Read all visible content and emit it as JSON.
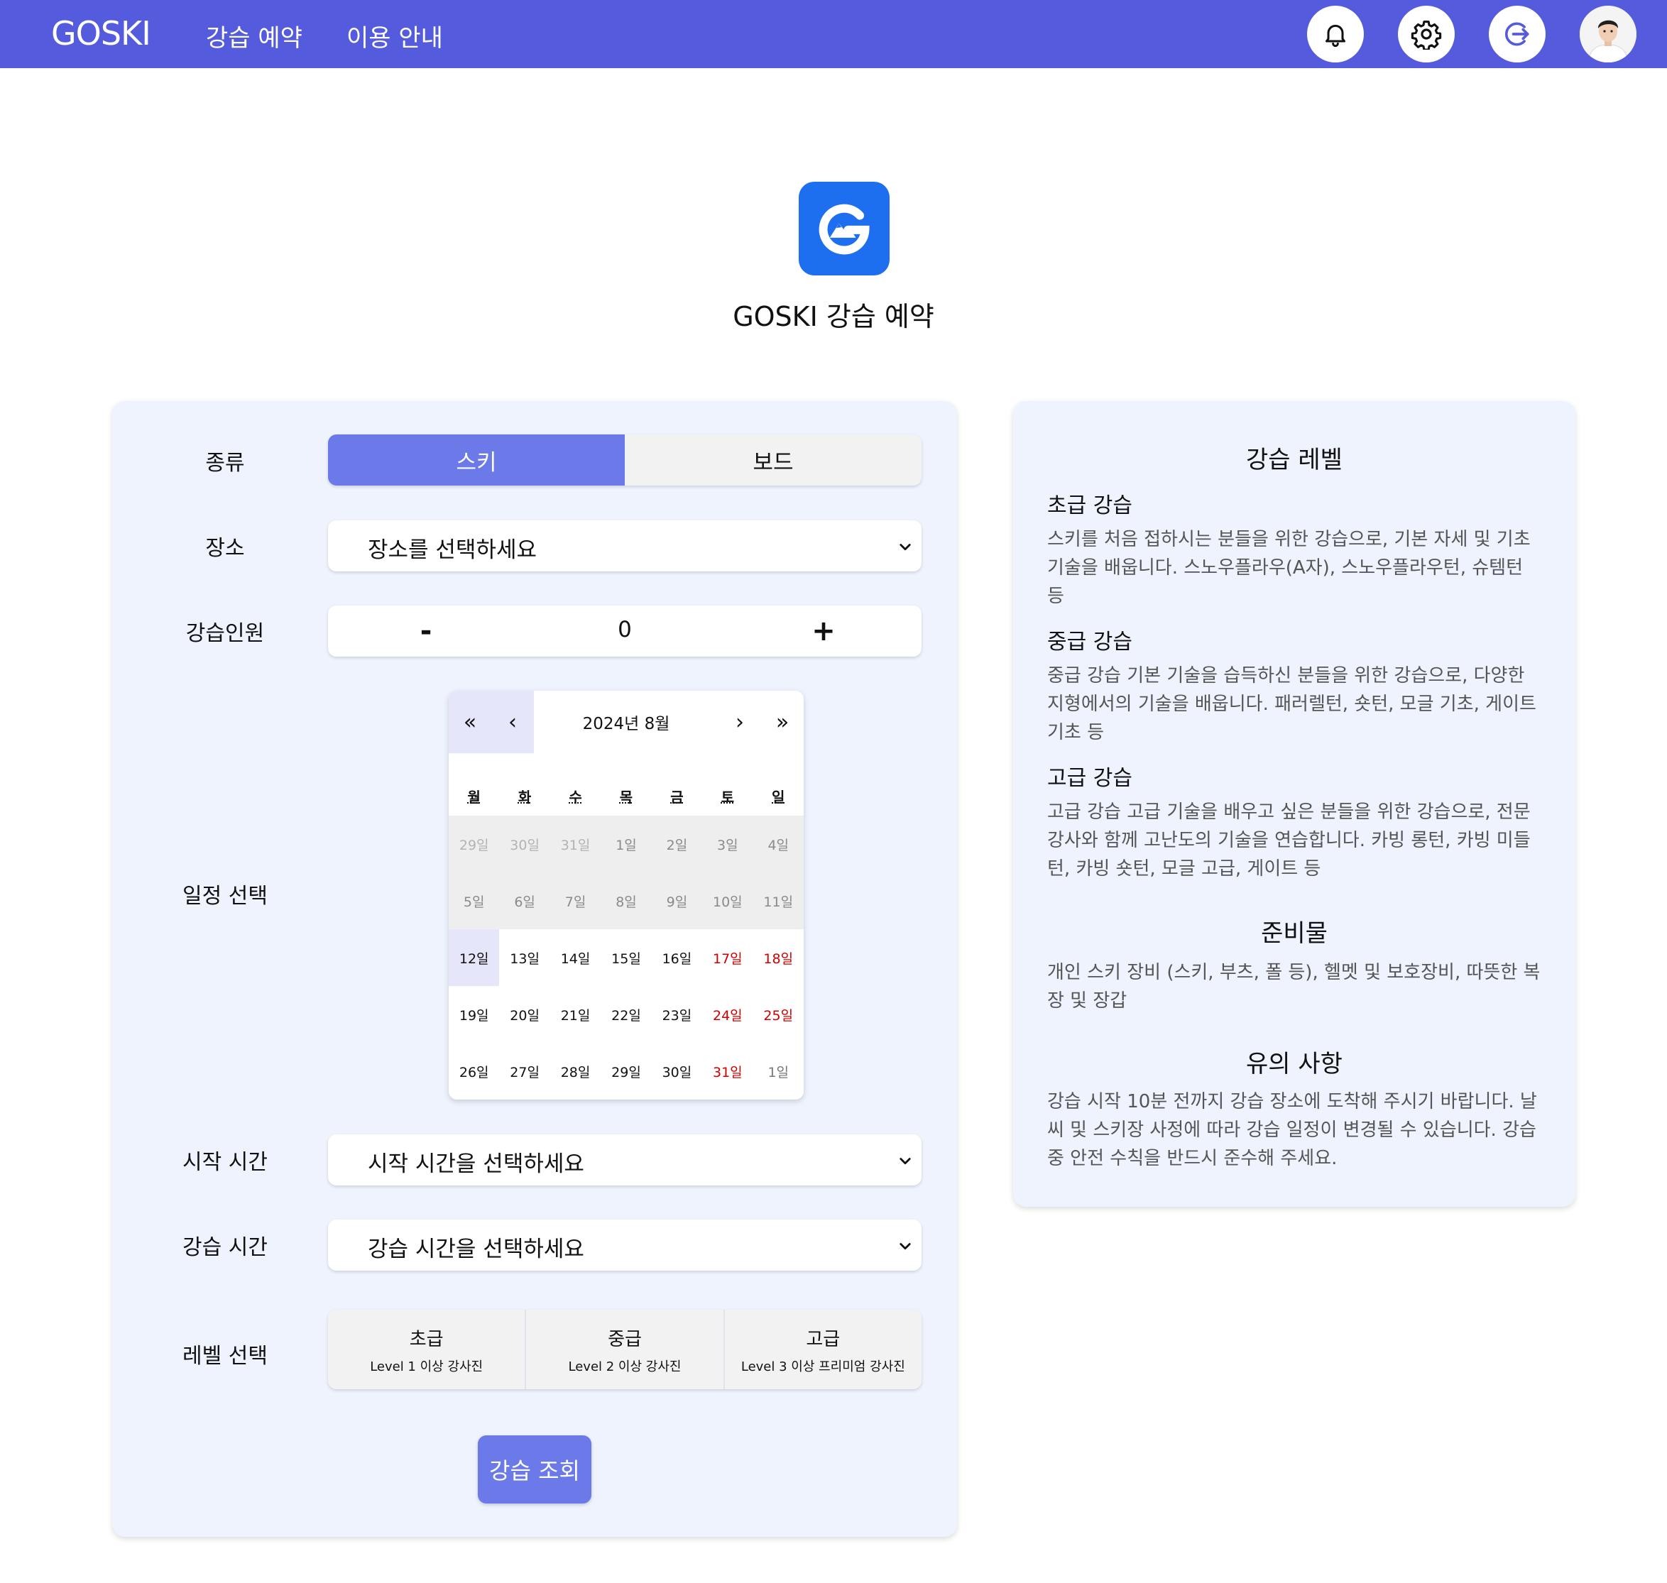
{
  "header": {
    "brand": "GOSKI",
    "nav": [
      "강습 예약",
      "이용 안내"
    ]
  },
  "hero": {
    "title": "GOSKI 강습 예약"
  },
  "form": {
    "type_label": "종류",
    "type_options": [
      "스키",
      "보드"
    ],
    "type_selected": "스키",
    "location_label": "장소",
    "location_placeholder": "장소를 선택하세요",
    "people_label": "강습인원",
    "people_minus": "-",
    "people_value": "0",
    "people_plus": "+",
    "schedule_label": "일정 선택",
    "start_label": "시작 시간",
    "start_placeholder": "시작 시간을 선택하세요",
    "duration_label": "강습 시간",
    "duration_placeholder": "강습 시간을 선택하세요",
    "level_label": "레벨 선택",
    "levels": [
      {
        "name": "초급",
        "desc": "Level 1 이상 강사진"
      },
      {
        "name": "중급",
        "desc": "Level 2 이상 강사진"
      },
      {
        "name": "고급",
        "desc": "Level 3 이상 프리미엄 강사진"
      }
    ],
    "search_button": "강습 조회"
  },
  "calendar": {
    "nav": {
      "prev2": "«",
      "prev": "‹",
      "next": "›",
      "next2": "»"
    },
    "month_label": "2024년 8월",
    "weekdays": [
      "월",
      "화",
      "수",
      "목",
      "금",
      "토",
      "일"
    ],
    "weeks": [
      [
        {
          "d": "29일",
          "s": "other"
        },
        {
          "d": "30일",
          "s": "other"
        },
        {
          "d": "31일",
          "s": "other"
        },
        {
          "d": "1일",
          "s": "past"
        },
        {
          "d": "2일",
          "s": "past"
        },
        {
          "d": "3일",
          "s": "past"
        },
        {
          "d": "4일",
          "s": "past"
        }
      ],
      [
        {
          "d": "5일",
          "s": "past"
        },
        {
          "d": "6일",
          "s": "past"
        },
        {
          "d": "7일",
          "s": "past"
        },
        {
          "d": "8일",
          "s": "past"
        },
        {
          "d": "9일",
          "s": "past"
        },
        {
          "d": "10일",
          "s": "past"
        },
        {
          "d": "11일",
          "s": "past"
        }
      ],
      [
        {
          "d": "12일",
          "s": "today"
        },
        {
          "d": "13일",
          "s": "normal"
        },
        {
          "d": "14일",
          "s": "normal"
        },
        {
          "d": "15일",
          "s": "normal"
        },
        {
          "d": "16일",
          "s": "normal"
        },
        {
          "d": "17일",
          "s": "weekend"
        },
        {
          "d": "18일",
          "s": "weekend"
        }
      ],
      [
        {
          "d": "19일",
          "s": "normal"
        },
        {
          "d": "20일",
          "s": "normal"
        },
        {
          "d": "21일",
          "s": "normal"
        },
        {
          "d": "22일",
          "s": "normal"
        },
        {
          "d": "23일",
          "s": "normal"
        },
        {
          "d": "24일",
          "s": "weekend"
        },
        {
          "d": "25일",
          "s": "weekend"
        }
      ],
      [
        {
          "d": "26일",
          "s": "normal"
        },
        {
          "d": "27일",
          "s": "normal"
        },
        {
          "d": "28일",
          "s": "normal"
        },
        {
          "d": "29일",
          "s": "normal"
        },
        {
          "d": "30일",
          "s": "normal"
        },
        {
          "d": "31일",
          "s": "weekend"
        },
        {
          "d": "1일",
          "s": "next"
        }
      ]
    ]
  },
  "info": {
    "levels_title": "강습 레벨",
    "beginner_title": "초급 강습",
    "beginner_text": "스키를 처음 접하시는 분들을 위한 강습으로, 기본 자세 및 기초 기술을 배웁니다. 스노우플라우(A자), 스노우플라우턴, 슈템턴 등",
    "intermediate_title": "중급 강습",
    "intermediate_text": "중급 강습 기본 기술을 습득하신 분들을 위한 강습으로, 다양한 지형에서의 기술을 배웁니다. 패러렐턴, 숏턴, 모글 기초, 게이트 기초 등",
    "advanced_title": "고급 강습",
    "advanced_text": "고급 강습 고급 기술을 배우고 싶은 분들을 위한 강습으로, 전문 강사와 함께 고난도의 기술을 연습합니다. 카빙 롱턴, 카빙 미들턴, 카빙 숏턴, 모글 고급, 게이트 등",
    "prep_title": "준비물",
    "prep_text": "개인 스키 장비 (스키, 부츠, 폴 등), 헬멧 및 보호장비, 따뜻한 복장 및 장갑",
    "notice_title": "유의 사항",
    "notice_text": "강습 시작 10분 전까지 강습 장소에 도착해 주시기 바랍니다. 날씨 및 스키장 사정에 따라 강습 일정이 변경될 수 있습니다. 강습 중 안전 수칙을 반드시 준수해 주세요."
  },
  "colors": {
    "header_bg": "#545bdc",
    "accent": "#6b7ae8",
    "logo_bg": "#1e6ff0",
    "panel_bg": "#eef3fe",
    "weekend_red": "#d10000"
  },
  "icons": {
    "notification": "bell-icon",
    "settings": "gear-icon",
    "logout": "logout-icon",
    "profile": "avatar"
  }
}
